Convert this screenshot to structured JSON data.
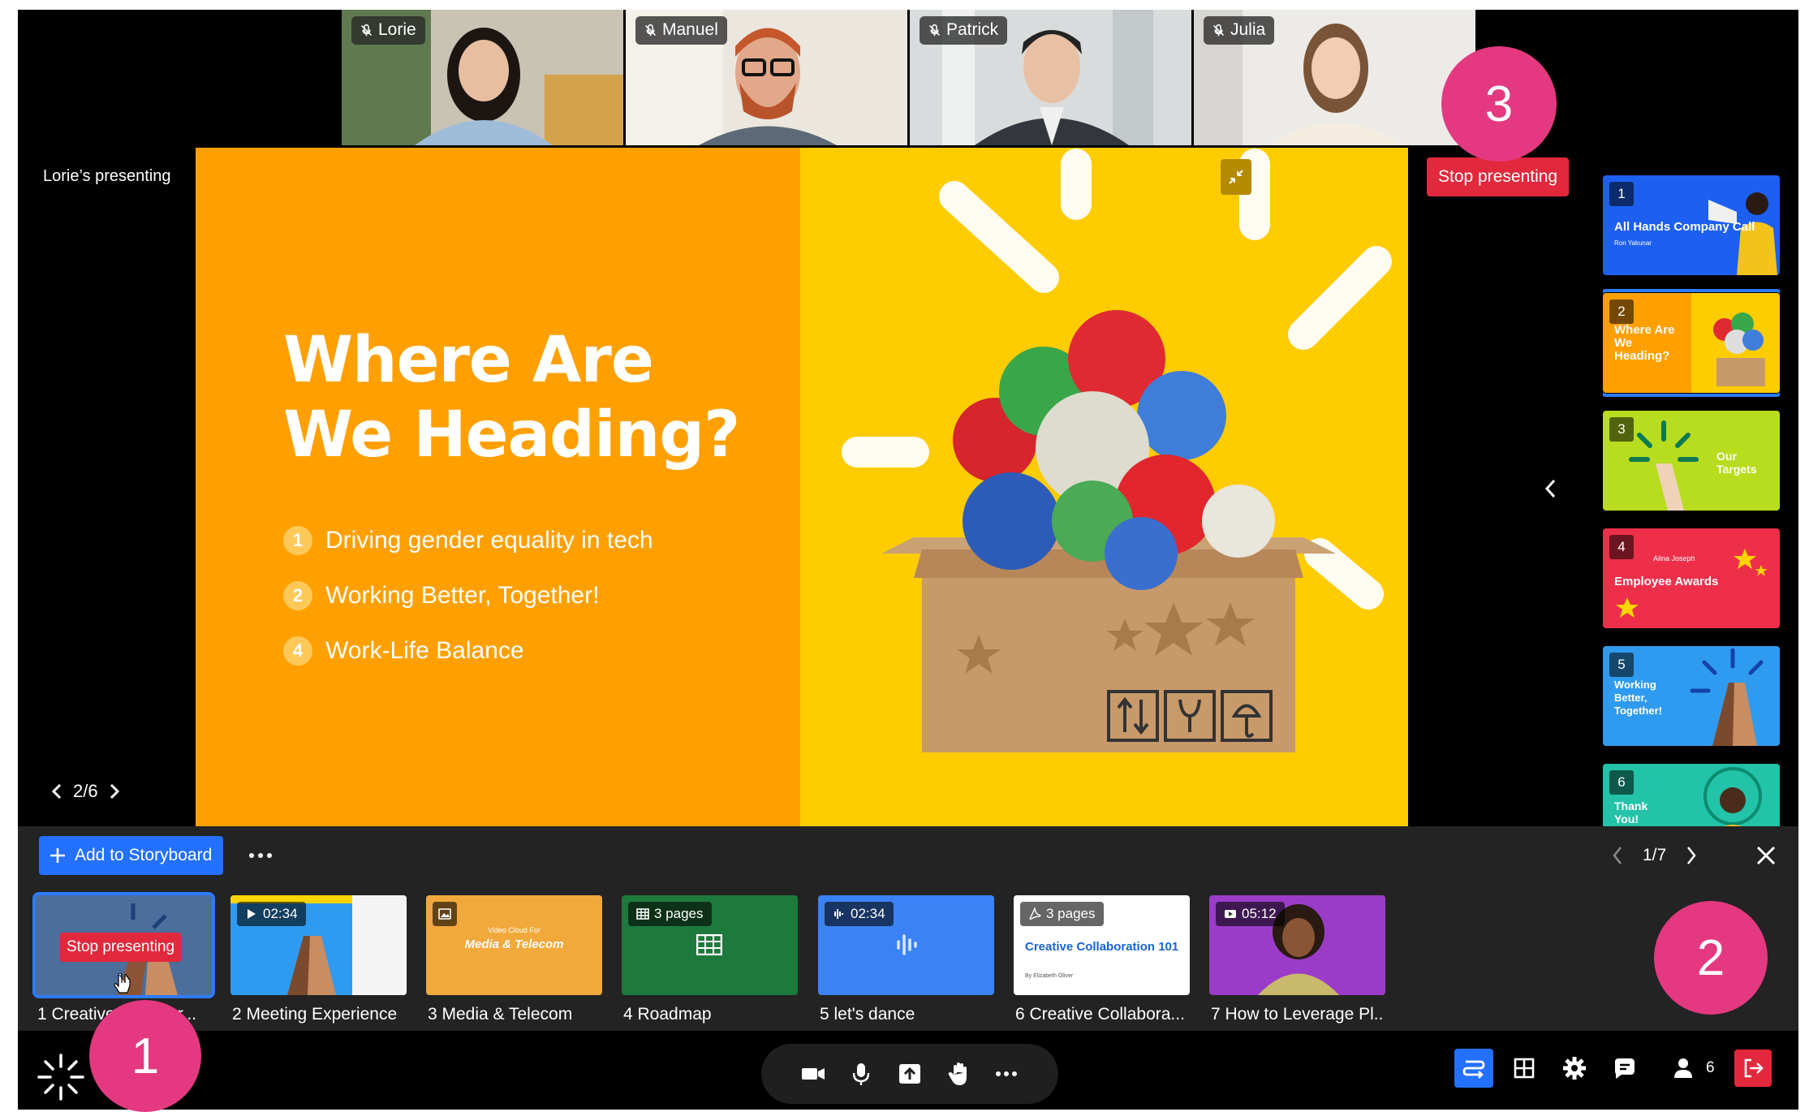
{
  "participants": [
    {
      "name": "Lorie"
    },
    {
      "name": "Manuel"
    },
    {
      "name": "Patrick"
    },
    {
      "name": "Julia"
    }
  ],
  "presenting_label": "Lorie’s presenting",
  "slide": {
    "title_line1": "Where Are",
    "title_line2": "We Heading?",
    "items": [
      {
        "num": "1",
        "text": "Driving gender equality in tech"
      },
      {
        "num": "2",
        "text": "Working Better, Together!"
      },
      {
        "num": "4",
        "text": "Work-Life Balance"
      }
    ]
  },
  "stop_presenting_label": "Stop presenting",
  "page_counter": "2/6",
  "rail": [
    {
      "num": "1",
      "title": "All Hands Company Call",
      "sub": "Ron Yakunar",
      "color": "#1d5ff0"
    },
    {
      "num": "2",
      "title": "Where Are We Heading?",
      "color": "#ffa000"
    },
    {
      "num": "3",
      "title": "Our Targets",
      "color": "#b8dc1e"
    },
    {
      "num": "4",
      "title": "Employee Awards",
      "sub": "Alina Joseph",
      "color": "#ee2f4a"
    },
    {
      "num": "5",
      "title": "Working Better, Together!",
      "color": "#2f9bf0"
    },
    {
      "num": "6",
      "title": "Thank You!",
      "color": "#22c3a8"
    }
  ],
  "storyboard": {
    "add_label": "Add to Storyboard",
    "page": "1/7",
    "stop_label": "Stop presenting",
    "items": [
      {
        "caption": "1 Creative Collabor...",
        "badge": ""
      },
      {
        "caption": "2 Meeting Experience",
        "badge": "02:34"
      },
      {
        "caption": "3 Media & Telecom",
        "badge": "",
        "inner": "Media & Telecom",
        "inner_small": "Video Cloud For"
      },
      {
        "caption": "4 Roadmap",
        "badge": "3 pages"
      },
      {
        "caption": "5 let's dance",
        "badge": "02:34"
      },
      {
        "caption": "6 Creative Collabora...",
        "badge": "3 pages",
        "inner": "Creative Collaboration 101",
        "inner_small": "By Elizabeth Oliver"
      },
      {
        "caption": "7 How to Leverage Pl..",
        "badge": "05:12"
      }
    ]
  },
  "people_count": "6",
  "callouts": [
    "1",
    "2",
    "3"
  ],
  "colors": {
    "accent": "#2470ff",
    "danger": "#e2283c",
    "callout": "#e43980"
  }
}
